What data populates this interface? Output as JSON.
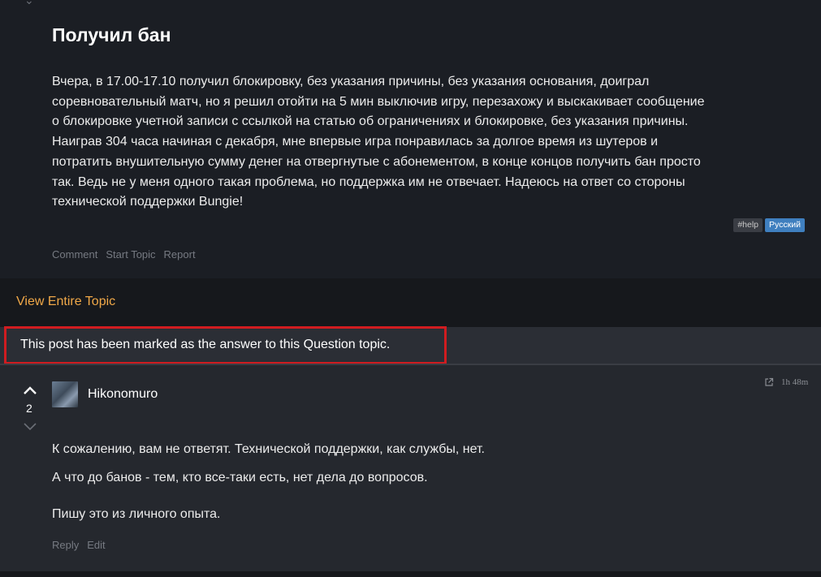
{
  "topic": {
    "title": "Получил бан",
    "body": "Вчера, в 17.00-17.10 получил блокировку, без указания причины, без указания основания, доиграл соревновательный матч, но я решил отойти на 5 мин выключив игру, перезахожу и выскакивает сообщение о блокировке учетной записи с ссылкой на статью об ограничениях и блокировке, без указания причины. Наиграв 304 часа начиная с декабря, мне впервые игра понравилась за долгое время из шутеров и потратить внушительную сумму денег на отвергнутые с абонементом, в конце концов получить бан просто так. Ведь не у меня одного такая проблема, но поддержка им не отвечает. Надеюсь на ответ со стороны технической поддержки Bungie!",
    "tags": [
      "#help",
      "Русский"
    ],
    "actions": {
      "comment": "Comment",
      "start_topic": "Start Topic",
      "report": "Report"
    }
  },
  "view_entire_topic": "View Entire Topic",
  "answer_banner": "This post has been marked as the answer to this Question topic.",
  "reply": {
    "votes": "2",
    "username": "Hikonomuro",
    "timestamp": "1h 48m",
    "paragraphs": [
      "К сожалению, вам не ответят. Технической поддержки, как службы, нет.",
      "А что до банов - тем, кто все-таки есть, нет дела до вопросов.",
      "Пишу это из личного опыта."
    ],
    "actions": {
      "reply": "Reply",
      "edit": "Edit"
    }
  },
  "colors": {
    "link_accent": "#f0a848",
    "highlight_border": "#d01c20",
    "tag_blue": "#3f7fbf"
  }
}
